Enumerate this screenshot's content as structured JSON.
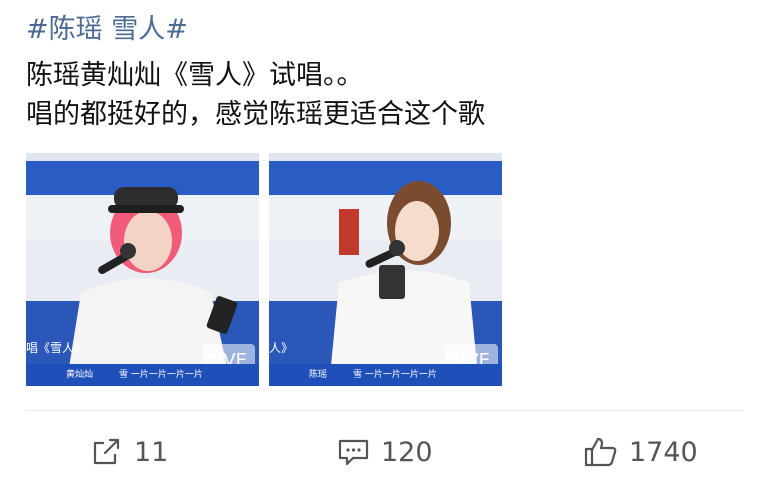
{
  "post": {
    "hashtag": "#陈瑶 雪人#",
    "line1": "陈瑶黄灿灿《雪人》试唱。。",
    "line2": "唱的都挺好的，感觉陈瑶更适合这个歌"
  },
  "media": [
    {
      "caption": "唱《雪人》",
      "ticker_name": "黄灿灿",
      "ticker_text": "雪 一片一片一片一片",
      "live_label": "LIVE"
    },
    {
      "caption": "人》",
      "ticker_name": "陈瑶",
      "ticker_text": "雪 一片一片一片一片",
      "live_label": "LIVE"
    }
  ],
  "actions": {
    "share_count": "11",
    "comment_count": "120",
    "like_count": "1740"
  },
  "colors": {
    "hashtag": "#4d6a92",
    "stage_blue": "#1f4fb8"
  }
}
